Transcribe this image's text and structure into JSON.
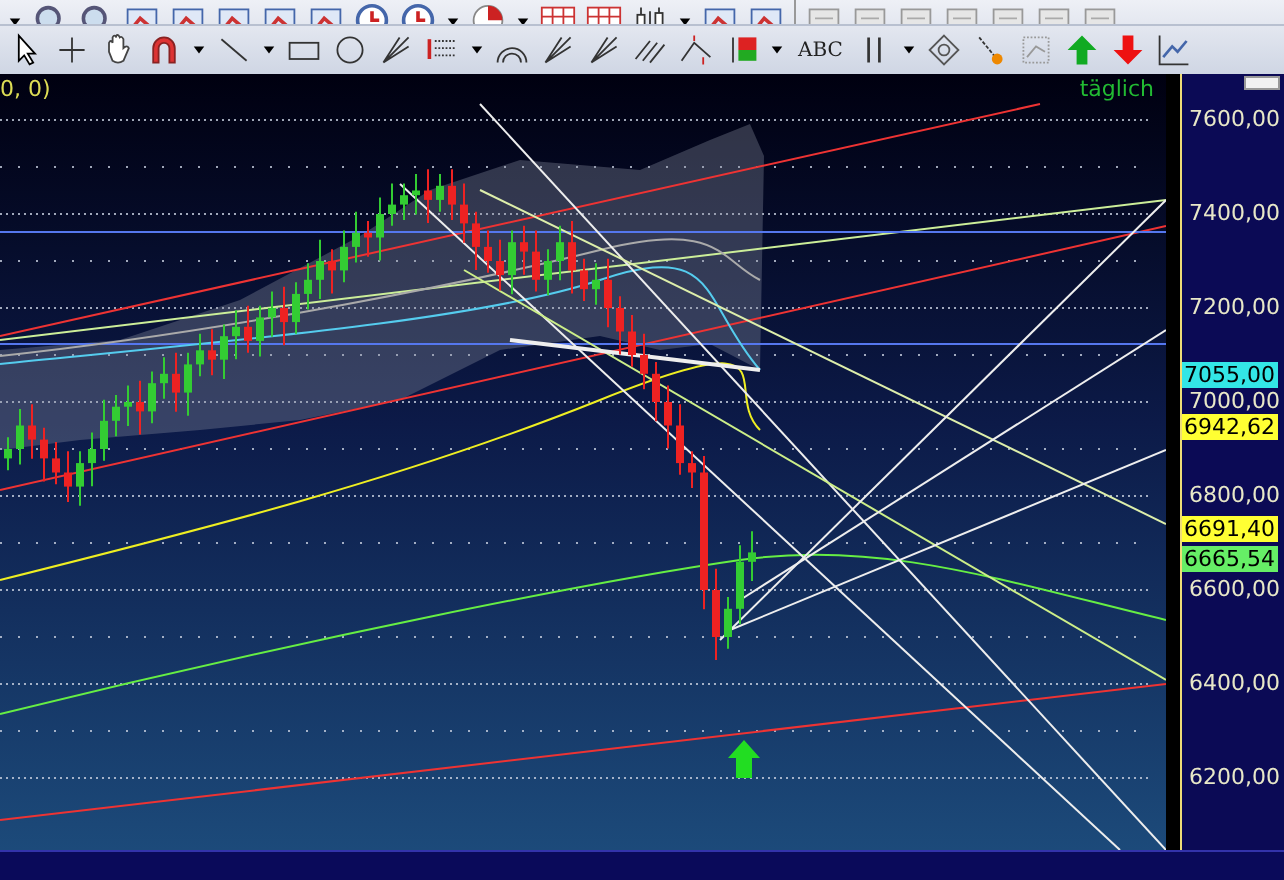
{
  "toolbar": {
    "text_tool": "ABC"
  },
  "chart": {
    "coords": "0, 0)",
    "period": "täglich",
    "axis_labels": [
      "7600,00",
      "7400,00",
      "7200,00",
      "7000,00",
      "6800,00",
      "6600,00",
      "6400,00",
      "6200,00"
    ],
    "price_tags": [
      {
        "text": "7055,00",
        "color": "#33e6e6"
      },
      {
        "text": "6942,62",
        "color": "#ffff33"
      },
      {
        "text": "6691,40",
        "color": "#ffff33"
      },
      {
        "text": "6665,54",
        "color": "#66ee66"
      }
    ]
  }
}
